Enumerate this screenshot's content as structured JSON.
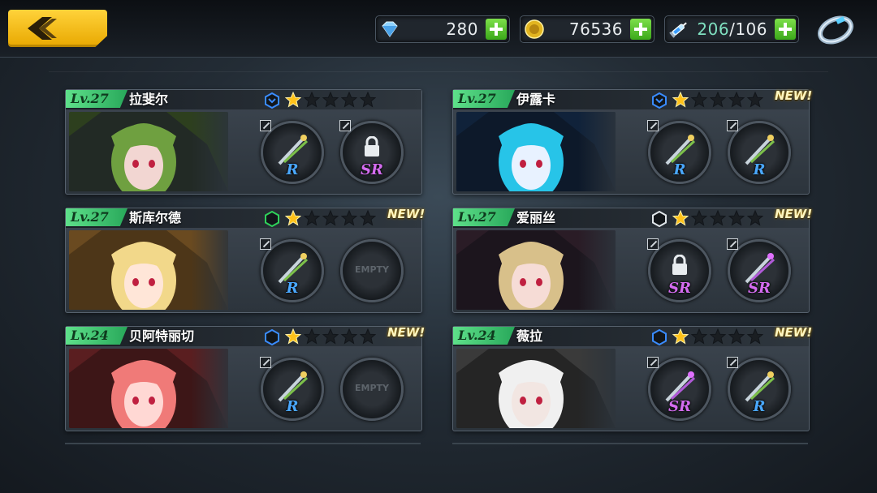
{
  "resources": {
    "diamonds": "280",
    "gold": "76536",
    "stamina_current": "206",
    "stamina_max": "/106"
  },
  "icons": {
    "back": "chevron-left-icon",
    "diamond": "diamond-icon",
    "gold": "gold-coin-icon",
    "stamina": "syringe-icon",
    "ring": "ring-icon"
  },
  "colors": {
    "accent_yellow": "#ffc21a",
    "level_green": "#3cc870",
    "rarity_r": "#4aa8ff",
    "rarity_sr": "#d46cf0",
    "rank_blue": "#3a8cff",
    "rank_green": "#2fd05a"
  },
  "characters": [
    {
      "level": "Lv.27",
      "name": "拉斐尔",
      "stars": 1,
      "max_stars": 5,
      "is_new": false,
      "new_label": "",
      "slot1": {
        "rarity": "R",
        "locked": false
      },
      "slot2": {
        "rarity": "SR",
        "locked": true
      }
    },
    {
      "level": "Lv.27",
      "name": "伊露卡",
      "stars": 1,
      "max_stars": 5,
      "is_new": true,
      "new_label": "NEW!",
      "slot1": {
        "rarity": "R",
        "locked": false
      },
      "slot2": {
        "rarity": "R",
        "locked": false
      }
    },
    {
      "level": "Lv.27",
      "name": "斯库尔德",
      "stars": 1,
      "max_stars": 5,
      "is_new": true,
      "new_label": "NEW!",
      "slot1": {
        "rarity": "R",
        "locked": false
      },
      "slot2": {
        "empty": "EMPTY"
      }
    },
    {
      "level": "Lv.27",
      "name": "爱丽丝",
      "stars": 1,
      "max_stars": 5,
      "is_new": true,
      "new_label": "NEW!",
      "slot1": {
        "rarity": "SR",
        "locked": true
      },
      "slot2": {
        "rarity": "SR",
        "locked": false
      }
    },
    {
      "level": "Lv.24",
      "name": "贝阿特丽切",
      "stars": 1,
      "max_stars": 5,
      "is_new": true,
      "new_label": "NEW!",
      "slot1": {
        "rarity": "R",
        "locked": false
      },
      "slot2": {
        "empty": "EMPTY"
      }
    },
    {
      "level": "Lv.24",
      "name": "薇拉",
      "stars": 1,
      "max_stars": 5,
      "is_new": true,
      "new_label": "NEW!",
      "slot1": {
        "rarity": "SR",
        "locked": false
      },
      "slot2": {
        "rarity": "R",
        "locked": false
      }
    }
  ]
}
